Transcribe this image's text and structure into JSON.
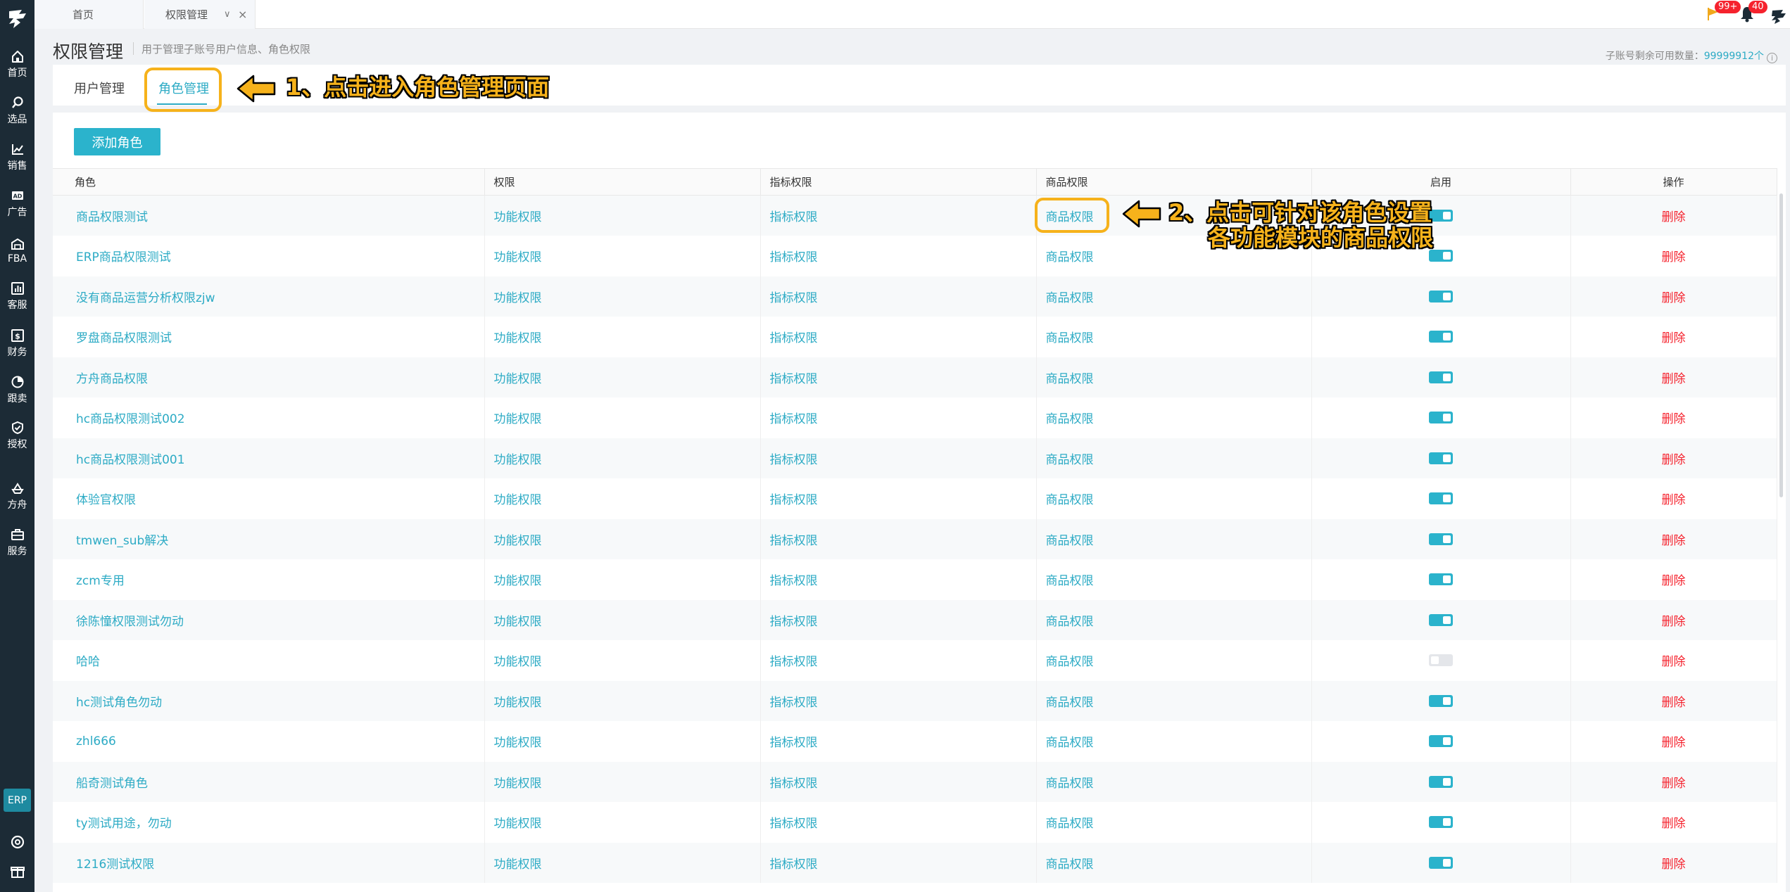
{
  "top_tabs": [
    {
      "label": "首页"
    },
    {
      "label": "权限管理"
    }
  ],
  "top_right": {
    "flag_badge": "99+",
    "bell_badge": "40"
  },
  "sidebar": {
    "items": [
      {
        "label": "首页",
        "icon": "home-icon"
      },
      {
        "label": "选品",
        "icon": "search-icon"
      },
      {
        "label": "销售",
        "icon": "chart-line-icon"
      },
      {
        "label": "广告",
        "icon": "ad-icon"
      },
      {
        "label": "FBA",
        "icon": "warehouse-icon"
      },
      {
        "label": "客服",
        "icon": "bar-chart-icon"
      },
      {
        "label": "财务",
        "icon": "dollar-icon"
      },
      {
        "label": "跟卖",
        "icon": "pie-chart-icon"
      },
      {
        "label": "授权",
        "icon": "shield-icon"
      },
      {
        "label": "方舟",
        "icon": "ark-icon"
      },
      {
        "label": "服务",
        "icon": "briefcase-icon"
      }
    ],
    "erp_label": "ERP"
  },
  "header": {
    "title": "权限管理",
    "subtitle": "用于管理子账号用户信息、角色权限",
    "quota_label": "子账号剩余可用数量：",
    "quota_value": "99999912个"
  },
  "subtabs": [
    {
      "label": "用户管理",
      "active": false
    },
    {
      "label": "角色管理",
      "active": true
    }
  ],
  "toolbar": {
    "add_role_label": "添加角色"
  },
  "table": {
    "columns": [
      "角色",
      "权限",
      "指标权限",
      "商品权限",
      "启用",
      "操作"
    ],
    "link_labels": {
      "func": "功能权限",
      "metric": "指标权限",
      "product": "商品权限",
      "delete": "删除"
    },
    "rows": [
      {
        "name": "商品权限测试",
        "enabled": true
      },
      {
        "name": "ERP商品权限测试",
        "enabled": true
      },
      {
        "name": "没有商品运营分析权限zjw",
        "enabled": true
      },
      {
        "name": "罗盘商品权限测试",
        "enabled": true
      },
      {
        "name": "方舟商品权限",
        "enabled": true
      },
      {
        "name": "hc商品权限测试002",
        "enabled": true
      },
      {
        "name": "hc商品权限测试001",
        "enabled": true
      },
      {
        "name": "体验官权限",
        "enabled": true
      },
      {
        "name": "tmwen_sub解决",
        "enabled": true
      },
      {
        "name": "zcm专用",
        "enabled": true
      },
      {
        "name": "徐陈憧权限测试勿动",
        "enabled": true
      },
      {
        "name": "哈哈",
        "enabled": false
      },
      {
        "name": "hc测试角色勿动",
        "enabled": true
      },
      {
        "name": "zhl666",
        "enabled": true
      },
      {
        "name": "船奇测试角色",
        "enabled": true
      },
      {
        "name": "ty测试用途，勿动",
        "enabled": true
      },
      {
        "name": "1216测试权限",
        "enabled": true
      }
    ]
  },
  "annotations": {
    "step1": "1、点击进入角色管理页面",
    "step2_line1": "2、点击可针对该角色设置",
    "step2_line2": "各功能模块的商品权限",
    "color": "#f6b21b"
  },
  "colors": {
    "accent": "#2dabc5",
    "sidebar": "#1c2b36",
    "danger": "#f5222d"
  }
}
